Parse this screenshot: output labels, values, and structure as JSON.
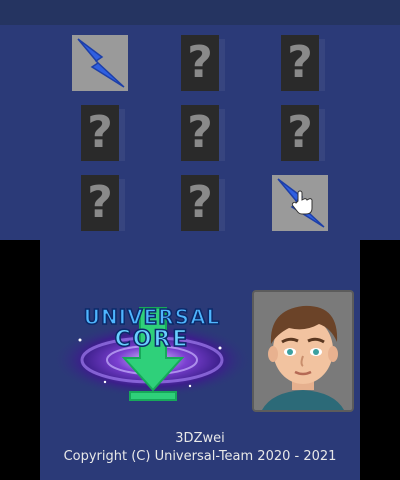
{
  "board": {
    "cards": [
      {
        "row": 0,
        "col": 0,
        "state": "revealed",
        "icon": "lightning-bolt-icon"
      },
      {
        "row": 0,
        "col": 1,
        "state": "hidden",
        "label": "?"
      },
      {
        "row": 0,
        "col": 2,
        "state": "hidden",
        "label": "?"
      },
      {
        "row": 1,
        "col": 0,
        "state": "hidden",
        "label": "?"
      },
      {
        "row": 1,
        "col": 1,
        "state": "hidden",
        "label": "?"
      },
      {
        "row": 1,
        "col": 2,
        "state": "hidden",
        "label": "?"
      },
      {
        "row": 2,
        "col": 0,
        "state": "hidden",
        "label": "?"
      },
      {
        "row": 2,
        "col": 1,
        "state": "hidden",
        "label": "?"
      },
      {
        "row": 2,
        "col": 2,
        "state": "revealed",
        "icon": "lightning-bolt-icon",
        "cursor": "hand-pointer-icon"
      }
    ]
  },
  "logo": {
    "text_line1": "UNIVERSAL",
    "text_line2": "CORE",
    "icon": "galaxy-download-arrow-icon"
  },
  "avatar": {
    "icon": "developer-avatar-icon"
  },
  "credits": {
    "author": "3DZwei",
    "copyright": "Copyright (C) Universal-Team 2020 - 2021"
  },
  "colors": {
    "background": "#2b3a78",
    "card_back": "#2a2a2a",
    "card_face": "#9a9a9a",
    "bolt": "#2f5fe0"
  }
}
